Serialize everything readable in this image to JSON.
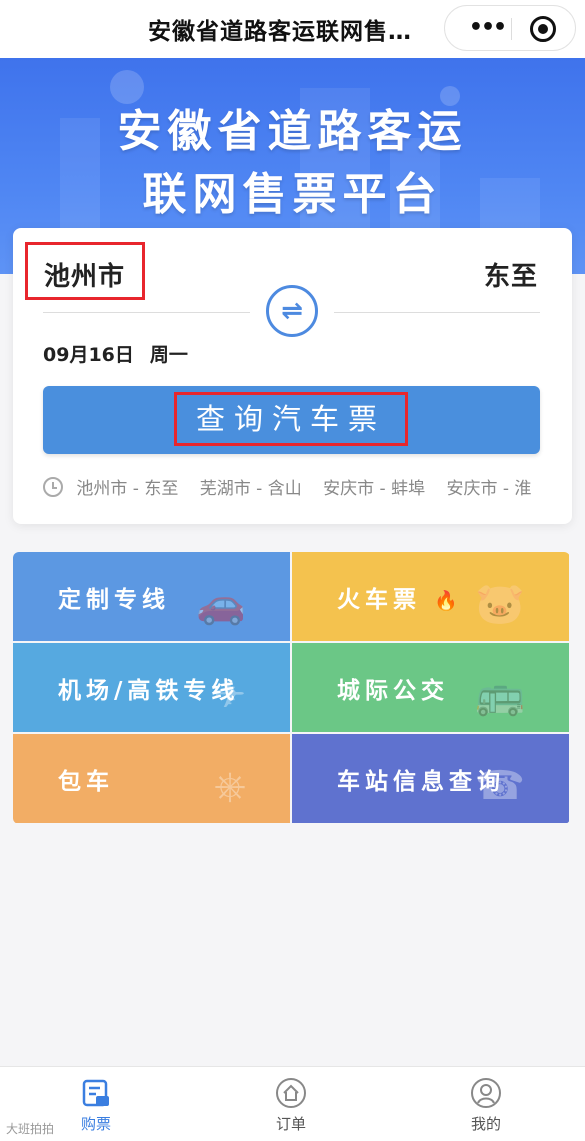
{
  "navbar": {
    "title": "安徽省道路客运联网售…",
    "more_label": "•••"
  },
  "banner": {
    "title_line1": "安徽省道路客运",
    "title_line2": "联网售票平台"
  },
  "search": {
    "from_city": "池州市",
    "to_city": "东至",
    "swap_glyph": "⇌",
    "date": "09月16日",
    "weekday": "周一",
    "button_label": "查询汽车票",
    "history": [
      "池州市 - 东至",
      "芜湖市 - 含山",
      "安庆市 - 蚌埠",
      "安庆市 - 淮"
    ]
  },
  "services": [
    {
      "label": "定制专线",
      "icon": "car-icon",
      "color": "#5c98e2"
    },
    {
      "label": "火车票",
      "icon": "train-mascot-icon",
      "color": "#f4c24e"
    },
    {
      "label": "机场/高铁专线",
      "icon": "plane-icon",
      "color": "#56a9e0"
    },
    {
      "label": "城际公交",
      "icon": "bus-icon",
      "color": "#6bc786"
    },
    {
      "label": "包车",
      "icon": "steering-wheel-icon",
      "color": "#f2ad65"
    },
    {
      "label": "车站信息查询",
      "icon": "phone-icon",
      "color": "#5f72cf"
    }
  ],
  "tabbar": {
    "buy": "购票",
    "order": "订单",
    "mine": "我的",
    "active_color": "#3a7ee0"
  },
  "watermark": "大班拍拍"
}
